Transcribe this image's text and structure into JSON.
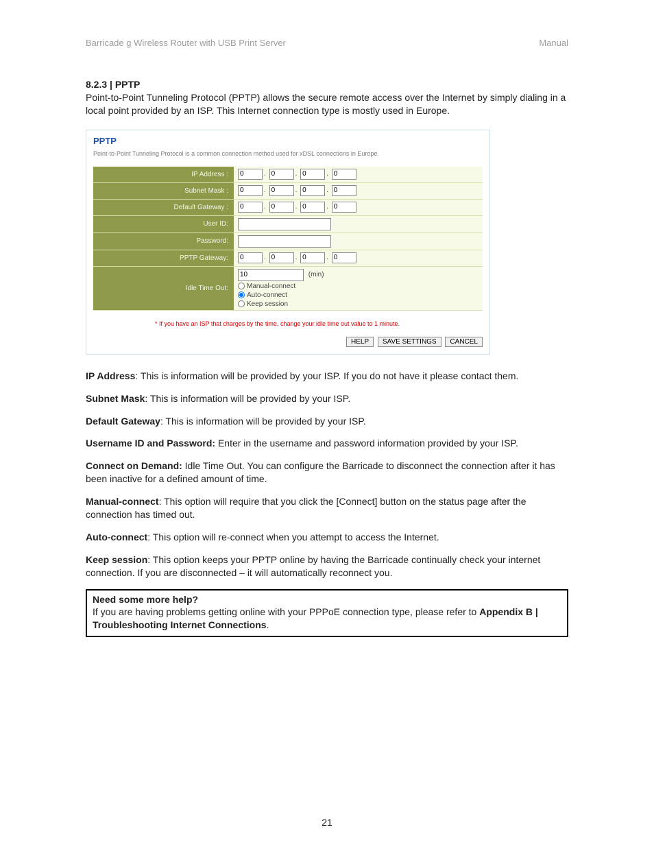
{
  "header": {
    "product": "Barricade g Wireless Router with USB Print Server",
    "doc_label": "Manual"
  },
  "section": {
    "number_title": "8.2.3 | PPTP",
    "intro": "Point-to-Point Tunneling Protocol (PPTP) allows the secure remote access over the Internet by simply dialing in a local point provided by an ISP. This Internet connection type is mostly used in Europe."
  },
  "config": {
    "title": "PPTP",
    "subtitle": "Point-to-Point Tunneling Protocol is a common connection method used for xDSL connections in Europe.",
    "labels": {
      "ip_address": "IP Address :",
      "subnet_mask": "Subnet Mask :",
      "default_gateway": "Default Gateway :",
      "user_id": "User ID:",
      "password": "Password:",
      "pptp_gateway": "PPTP Gateway:",
      "idle_timeout": "Idle Time Out:"
    },
    "ip_address": [
      "0",
      "0",
      "0",
      "0"
    ],
    "subnet_mask": [
      "0",
      "0",
      "0",
      "0"
    ],
    "default_gateway": [
      "0",
      "0",
      "0",
      "0"
    ],
    "user_id": "",
    "password": "",
    "pptp_gateway": [
      "0",
      "0",
      "0",
      "0"
    ],
    "idle_time_value": "10",
    "idle_time_unit": "(min)",
    "radio": {
      "manual": "Manual-connect",
      "auto": "Auto-connect",
      "keep": "Keep session",
      "selected": "auto"
    },
    "warning": "* If you have an ISP that charges by the time, change your idle time out value to 1 minute.",
    "buttons": {
      "help": "HELP",
      "save": "SAVE SETTINGS",
      "cancel": "CANCEL"
    }
  },
  "descriptions": [
    {
      "term": "IP Address",
      "sep": ": ",
      "text": "This is information will be provided by your ISP.  If you do not have it please contact them."
    },
    {
      "term": "Subnet Mask",
      "sep": ": ",
      "text": "This is information will be provided by your ISP."
    },
    {
      "term": "Default Gateway",
      "sep": ": ",
      "text": "This is information will be provided by your ISP."
    },
    {
      "term": "Username ID and Password:",
      "sep": " ",
      "text": "Enter in the username and password information provided by your ISP."
    },
    {
      "term": "Connect on Demand:",
      "sep": "  ",
      "text": "Idle Time Out. You can configure the Barricade to disconnect the connection after it has been inactive for a defined amount of time."
    },
    {
      "term": "Manual-connect",
      "sep": ": ",
      "text": "This option will require that you click the [Connect] button on the status page after the connection has timed out."
    },
    {
      "term": "Auto-connect",
      "sep": ": ",
      "text": "This option will re-connect when you attempt to access the Internet."
    },
    {
      "term": "Keep session",
      "sep": ": ",
      "text": "This option keeps your PPTP online by having the Barricade continually check your internet connection.  If you are disconnected – it will automatically reconnect you."
    }
  ],
  "help_box": {
    "title": "Need some more help?",
    "body": "If you are having problems getting online with your PPPoE connection type, please refer to ",
    "appendix": "Appendix B | Troubleshooting Internet Connections",
    "tail": "."
  },
  "page_number": "21"
}
